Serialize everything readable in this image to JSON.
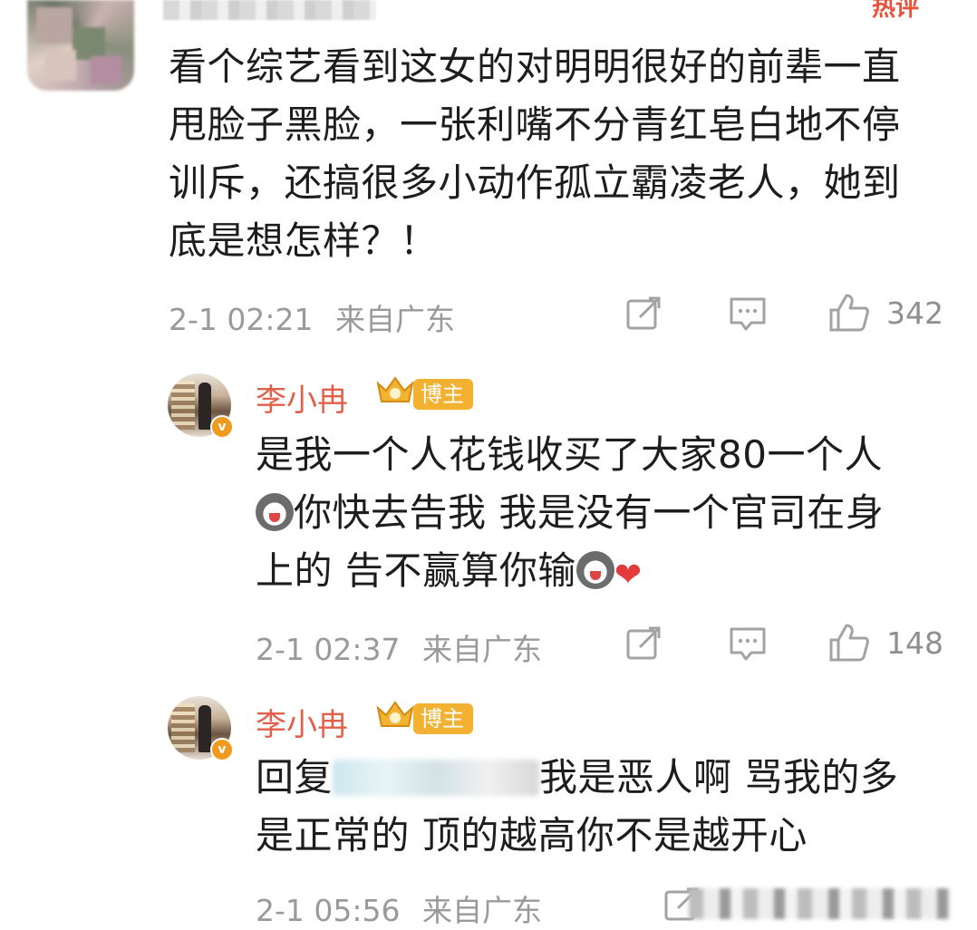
{
  "hot_label": "热评",
  "comments": [
    {
      "text_lines": [
        "看个综艺看到这女的对明明很好的前辈一直",
        "甩脸子黑脸，一张利嘴不分青红皂白地不停",
        "训斥，还搞很多小动作孤立霸凌老人，她到",
        "底是想怎样？！"
      ],
      "time": "2-1 02:21",
      "location": "来自广东",
      "likes": "342"
    }
  ],
  "replies": [
    {
      "username": "李小冉",
      "badge": "博主",
      "text_lines": [
        "是我一个人花钱收买了大家80一个人",
        "你快去告我 我是没有一个官司在身",
        "上的 告不赢算你输"
      ],
      "time": "2-1 02:37",
      "location": "来自广东",
      "likes": "148"
    },
    {
      "username": "李小冉",
      "badge": "博主",
      "reply_prefix": "回复",
      "text_lines": [
        "我是恶人啊 骂我的多",
        "是正常的 顶的越高你不是越开心"
      ],
      "time": "2-1 05:56",
      "location": "来自广东"
    }
  ],
  "icons": {
    "share": "share-icon",
    "comment": "comment-icon",
    "like": "thumbs-up-icon",
    "verified": "verified-badge-icon",
    "crown": "crown-icon"
  },
  "colors": {
    "username": "#e0604a",
    "badge": "#f3b131",
    "hot": "#e8513a",
    "meta": "#9a9a9a"
  }
}
